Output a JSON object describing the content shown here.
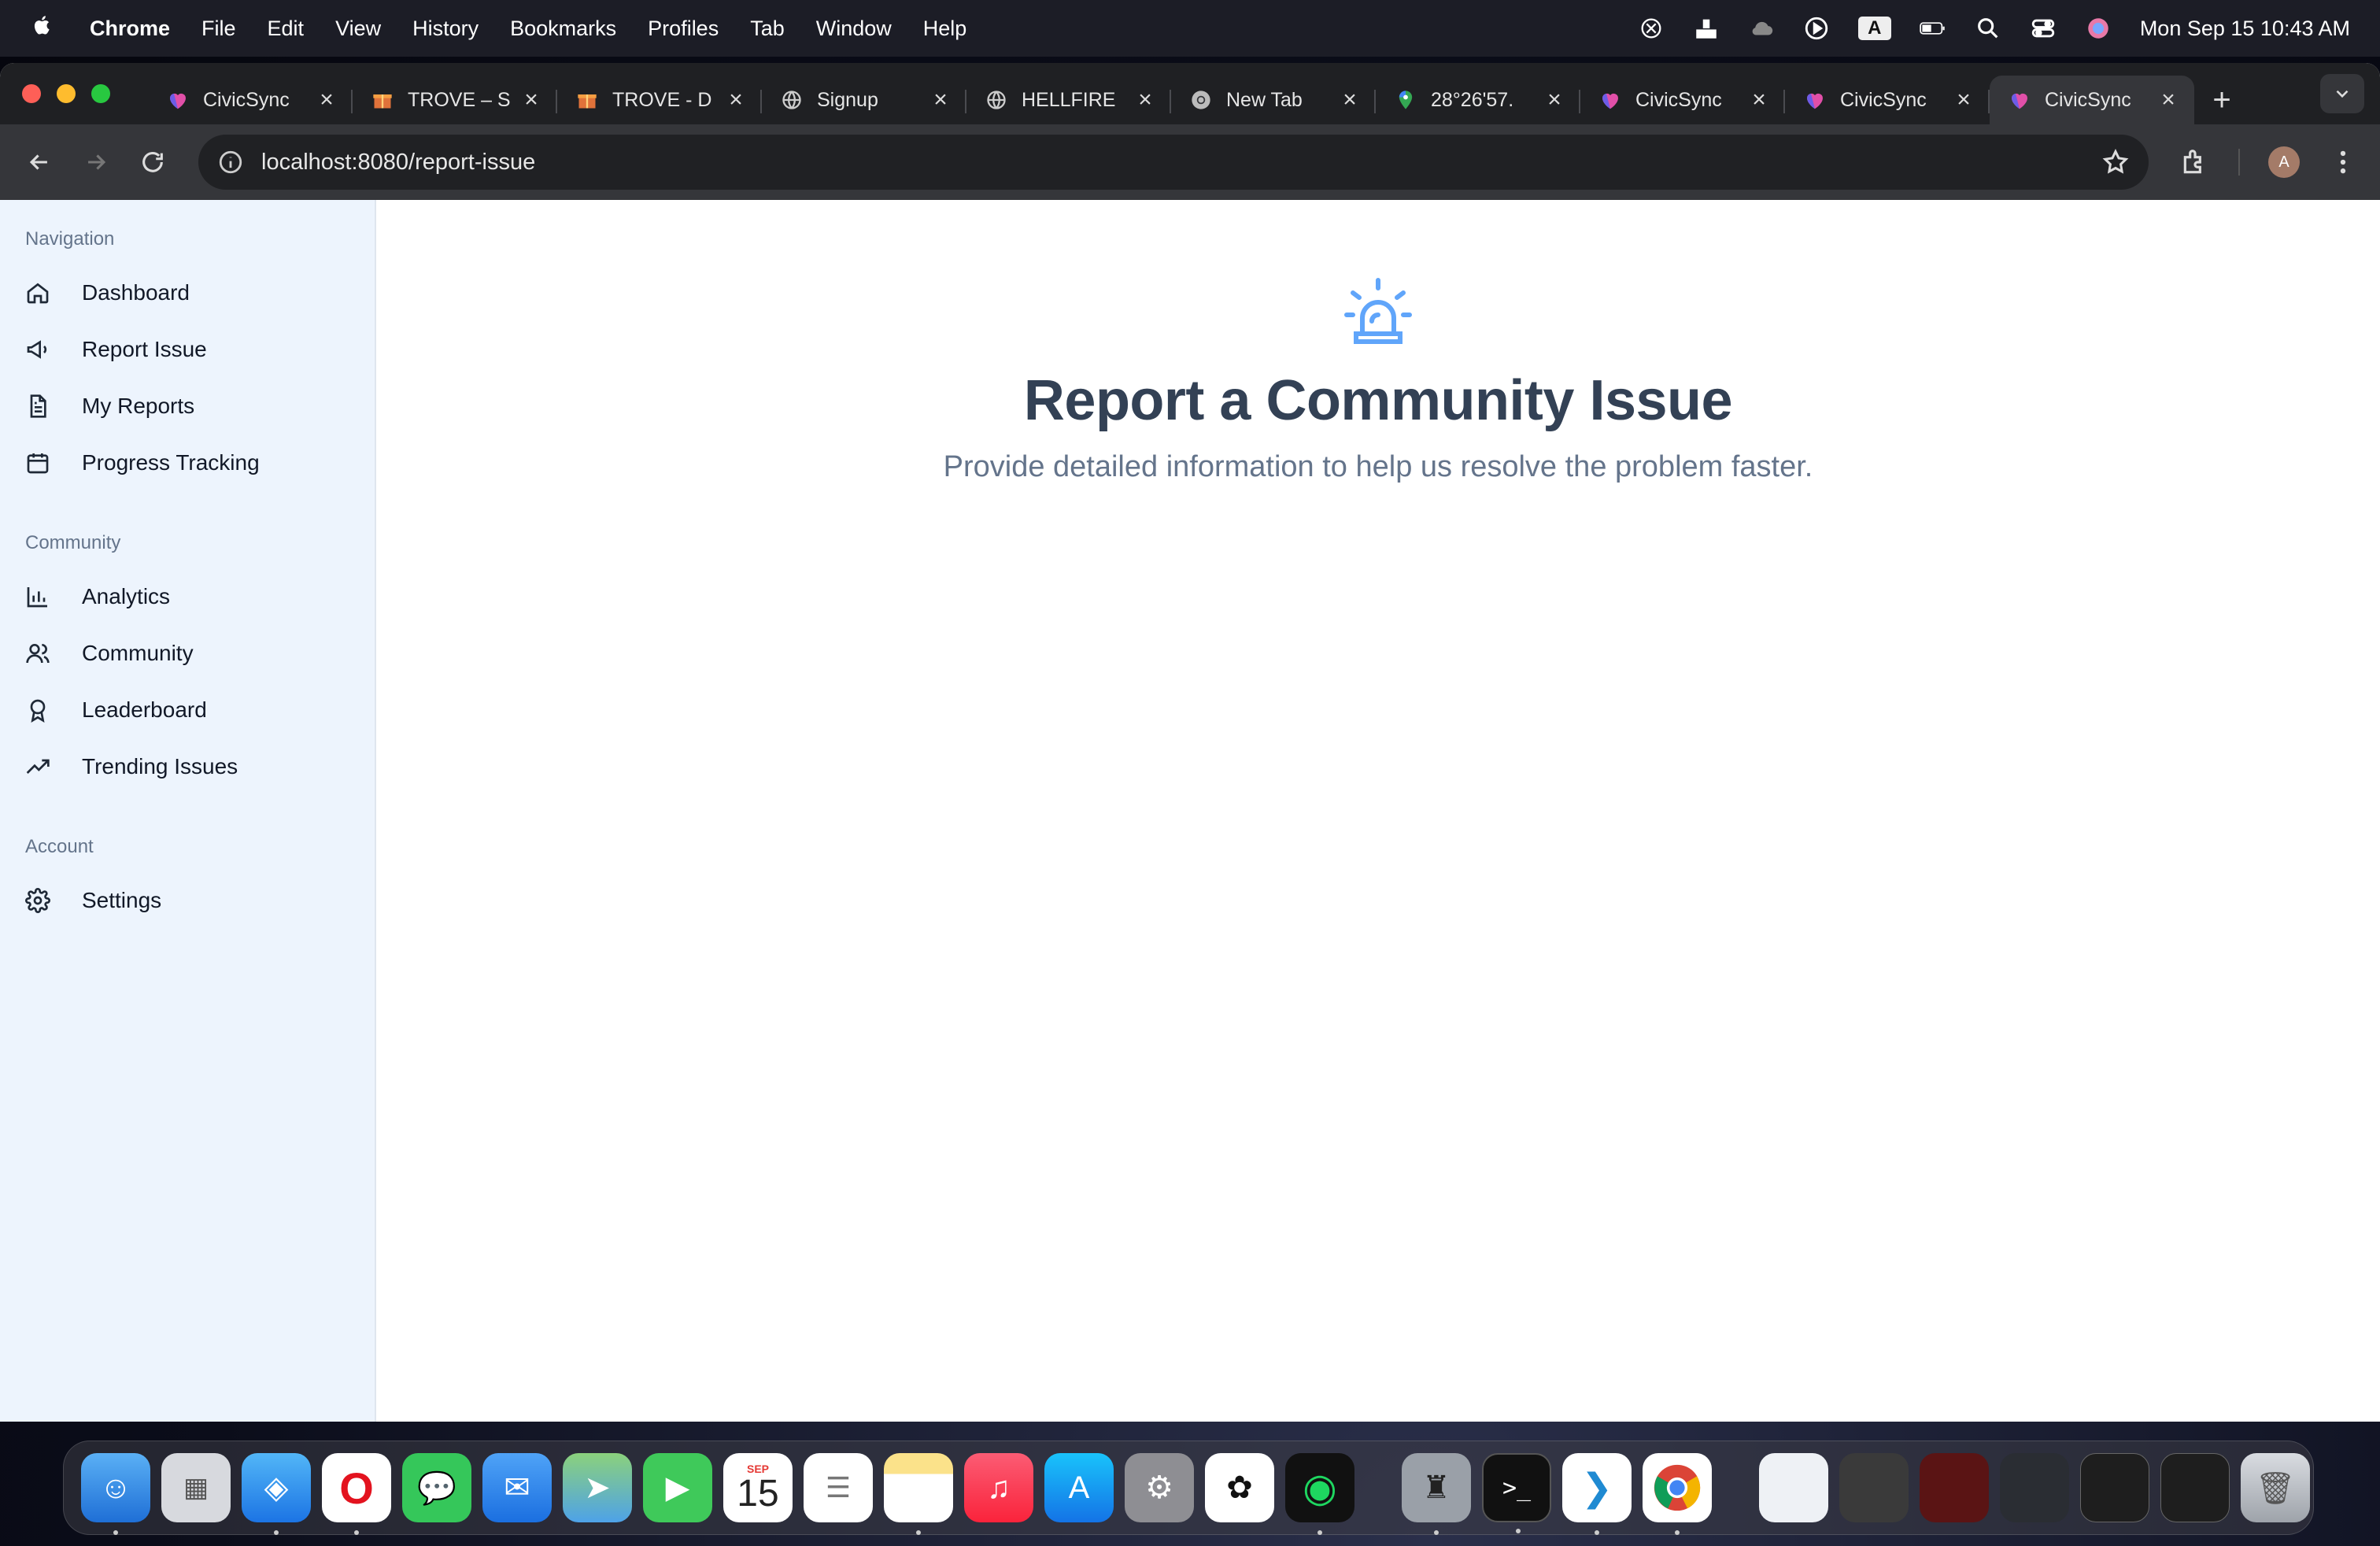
{
  "menubar": {
    "app_name": "Chrome",
    "menus": [
      "File",
      "Edit",
      "View",
      "History",
      "Bookmarks",
      "Profiles",
      "Tab",
      "Window",
      "Help"
    ],
    "input_indicator": "A",
    "clock": "Mon Sep 15  10:43 AM"
  },
  "browser": {
    "tabs": [
      {
        "title": "CivicSync",
        "favicon": "civicsync-heart-icon",
        "active": false
      },
      {
        "title": "TROVE – S",
        "favicon": "trove-gift-icon",
        "active": false
      },
      {
        "title": "TROVE - D",
        "favicon": "trove-gift-icon",
        "active": false
      },
      {
        "title": "Signup",
        "favicon": "globe-icon",
        "active": false
      },
      {
        "title": "HELLFIRE",
        "favicon": "globe-icon",
        "active": false
      },
      {
        "title": "New Tab",
        "favicon": "chrome-icon",
        "active": false
      },
      {
        "title": "28°26'57.",
        "favicon": "maps-pin-icon",
        "active": false
      },
      {
        "title": "CivicSync",
        "favicon": "civicsync-heart-icon",
        "active": false
      },
      {
        "title": "CivicSync",
        "favicon": "civicsync-heart-icon",
        "active": false
      },
      {
        "title": "CivicSync",
        "favicon": "civicsync-heart-icon",
        "active": true
      }
    ],
    "url": "localhost:8080/report-issue",
    "profile_initial": "A"
  },
  "sidebar": {
    "groups": [
      {
        "label": "Navigation",
        "items": [
          {
            "label": "Dashboard",
            "icon": "home-icon"
          },
          {
            "label": "Report Issue",
            "icon": "megaphone-icon"
          },
          {
            "label": "My Reports",
            "icon": "file-text-icon"
          },
          {
            "label": "Progress Tracking",
            "icon": "calendar-icon"
          }
        ]
      },
      {
        "label": "Community",
        "items": [
          {
            "label": "Analytics",
            "icon": "bar-chart-icon"
          },
          {
            "label": "Community",
            "icon": "users-icon"
          },
          {
            "label": "Leaderboard",
            "icon": "award-icon"
          },
          {
            "label": "Trending Issues",
            "icon": "trending-up-icon"
          }
        ]
      },
      {
        "label": "Account",
        "items": [
          {
            "label": "Settings",
            "icon": "gear-icon"
          }
        ]
      }
    ]
  },
  "main": {
    "hero_icon": "siren-icon",
    "title": "Report a Community Issue",
    "subtitle": "Provide detailed information to help us resolve the problem faster."
  },
  "dock": {
    "calendar_month": "SEP",
    "calendar_day": "15"
  },
  "colors": {
    "accent": "#60a5fa",
    "sidebar_bg": "#edf4fd",
    "heading": "#334155",
    "muted": "#64748b"
  }
}
